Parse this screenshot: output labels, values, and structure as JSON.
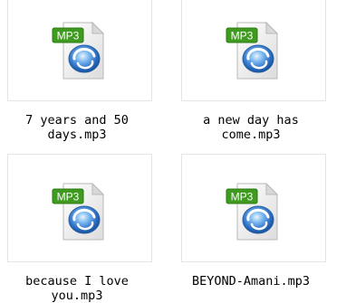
{
  "files": [
    {
      "name": "7 years and 50 days.mp3",
      "name_lines": [
        "7 years and 50",
        "days.mp3"
      ],
      "icon": "mp3-file-icon",
      "badge": "MP3"
    },
    {
      "name": "a new day has come.mp3",
      "name_lines": [
        "a new day has",
        "come.mp3"
      ],
      "icon": "mp3-file-icon",
      "badge": "MP3"
    },
    {
      "name": "because I love you.mp3",
      "name_lines": [
        "because I love",
        "you.mp3"
      ],
      "icon": "mp3-file-icon",
      "badge": "MP3"
    },
    {
      "name": "BEYOND-Amani.mp3",
      "name_lines": [
        "BEYOND-Amani.mp3"
      ],
      "icon": "mp3-file-icon",
      "badge": "MP3"
    }
  ],
  "colors": {
    "badge_green": "#3f9b1f",
    "badge_text": "#ffffff",
    "disc_blue": "#2a6fc4",
    "page_fold": "#d8d8d8",
    "frame_border": "#e4e4e4"
  }
}
